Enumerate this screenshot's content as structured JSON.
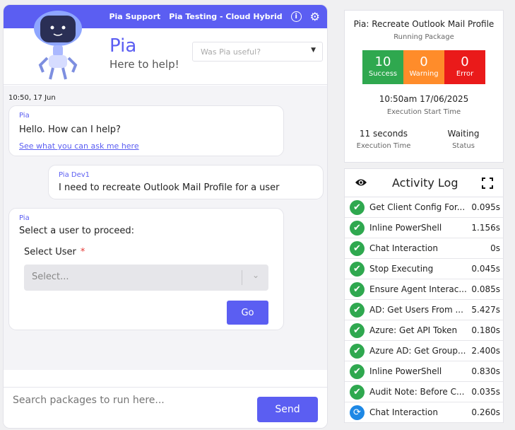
{
  "chat": {
    "topbar": {
      "support_label": "Pia Support",
      "tenant_label": "Pia Testing - Cloud Hybrid",
      "info_icon": "info-icon",
      "settings_icon": "gear-icon"
    },
    "header": {
      "name": "Pia",
      "subtitle": "Here to help!",
      "feedback_placeholder": "Was Pia useful?"
    },
    "timestamp": "10:50, 17 Jun",
    "messages": [
      {
        "from": "Pia",
        "text": "Hello. How can I help?",
        "link": "See what you can ask me here"
      },
      {
        "from": "Pia Dev1",
        "text": "I need to recreate Outlook Mail Profile for a user"
      },
      {
        "from": "Pia",
        "text": "Select a user to proceed:",
        "field_label": "Select User",
        "required_mark": "*",
        "select_placeholder": "Select...",
        "button": "Go"
      }
    ],
    "footer": {
      "search_placeholder": "Search packages to run here...",
      "send_label": "Send"
    }
  },
  "package": {
    "title": "Pia: Recreate Outlook Mail Profile",
    "status_text": "Running Package",
    "counts": [
      {
        "value": "10",
        "label": "Success",
        "color": "#2fa84f"
      },
      {
        "value": "0",
        "label": "Warning",
        "color": "#ff8c2a"
      },
      {
        "value": "0",
        "label": "Error",
        "color": "#ea1a1a"
      }
    ],
    "start_time": "10:50am 17/06/2025",
    "start_time_label": "Execution Start Time",
    "execution_time": "11 seconds",
    "execution_time_label": "Execution Time",
    "status": "Waiting",
    "status_label": "Status"
  },
  "activity_log": {
    "title": "Activity Log",
    "rows": [
      {
        "name": "Get Client Config For...",
        "time": "0.095s",
        "state": "done"
      },
      {
        "name": "Inline PowerShell",
        "time": "1.156s",
        "state": "done"
      },
      {
        "name": "Chat Interaction",
        "time": "0s",
        "state": "done"
      },
      {
        "name": "Stop Executing",
        "time": "0.045s",
        "state": "done"
      },
      {
        "name": "Ensure Agent Interac...",
        "time": "0.085s",
        "state": "done"
      },
      {
        "name": "AD: Get Users From ...",
        "time": "5.427s",
        "state": "done"
      },
      {
        "name": "Azure: Get API Token",
        "time": "0.180s",
        "state": "done"
      },
      {
        "name": "Azure AD: Get Group...",
        "time": "2.400s",
        "state": "done"
      },
      {
        "name": "Inline PowerShell",
        "time": "0.830s",
        "state": "done"
      },
      {
        "name": "Audit Note: Before C...",
        "time": "0.035s",
        "state": "done"
      },
      {
        "name": "Chat Interaction",
        "time": "0.260s",
        "state": "running"
      }
    ]
  }
}
